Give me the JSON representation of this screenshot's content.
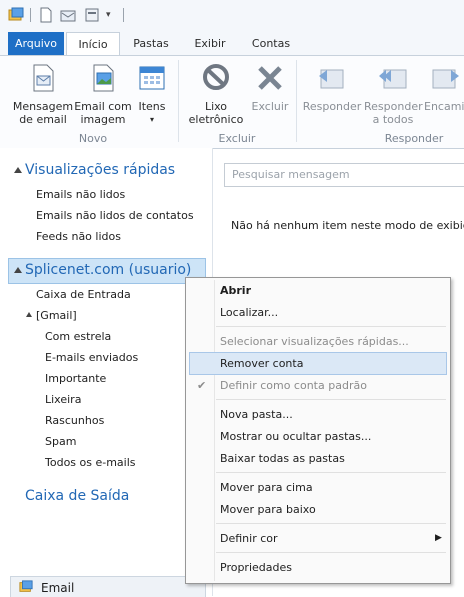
{
  "ribbon_tabs": [
    "Arquivo",
    "Início",
    "Pastas",
    "Exibir",
    "Contas"
  ],
  "ribbon": {
    "buttons": {
      "new_email": "Mensagem de email",
      "email_image": "Email com imagem",
      "items": "Itens",
      "junk": "Lixo eletrônico",
      "delete": "Excluir",
      "reply": "Responder",
      "reply_all": "Responder a todos",
      "forward": "Encaminhar"
    },
    "groups": {
      "new": "Novo",
      "delete": "Excluir",
      "respond": "Responder"
    }
  },
  "left_pane": {
    "quick_views_title": "Visualizações rápidas",
    "quick_views": [
      "Emails não lidos",
      "Emails não lidos de contatos",
      "Feeds não lidos"
    ],
    "account": "Splicenet.com (usuario)",
    "inbox": "Caixa de Entrada",
    "gmail_folder": "[Gmail]",
    "gmail_items": [
      "Com estrela",
      "E-mails enviados",
      "Importante",
      "Lixeira",
      "Rascunhos",
      "Spam",
      "Todos os e-mails"
    ],
    "outbox": "Caixa de Saída",
    "bottom_nav": "Email"
  },
  "search": {
    "placeholder": "Pesquisar mensagem"
  },
  "empty_message": "Não há nenhum item neste modo de exibição",
  "context_menu": {
    "open": "Abrir",
    "find": "Localizar...",
    "select_quick_views": "Selecionar visualizações rápidas...",
    "remove_account": "Remover conta",
    "set_default": "Definir como conta padrão",
    "new_folder": "Nova pasta...",
    "show_hide": "Mostrar ou ocultar pastas...",
    "download_all": "Baixar todas as pastas",
    "move_up": "Mover para cima",
    "move_down": "Mover para baixo",
    "set_color": "Definir cor",
    "properties": "Propriedades"
  },
  "colors": {
    "accent": "#1e6fc6",
    "section_title": "#2268b5",
    "selection": "#cde4f7"
  }
}
